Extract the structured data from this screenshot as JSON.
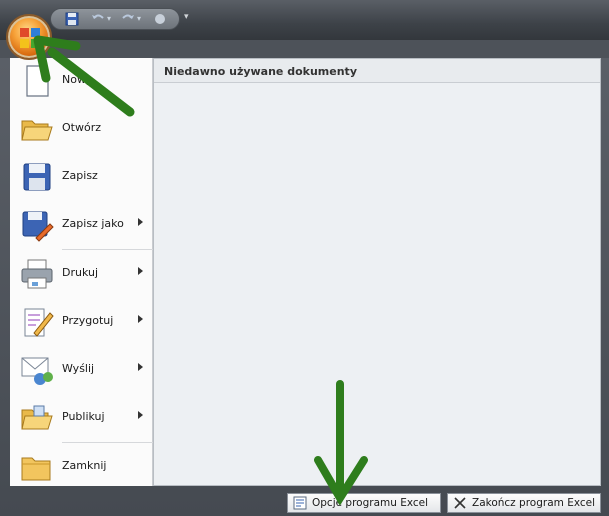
{
  "menu": {
    "commands": [
      {
        "label": "Nowy",
        "icon": "new-document-icon",
        "has_submenu": false
      },
      {
        "label": "Otwórz",
        "icon": "open-folder-icon",
        "has_submenu": false
      },
      {
        "label": "Zapisz",
        "icon": "save-disk-icon",
        "has_submenu": false
      },
      {
        "label": "Zapisz jako",
        "icon": "save-as-icon",
        "has_submenu": true
      },
      {
        "label": "Drukuj",
        "icon": "printer-icon",
        "has_submenu": true
      },
      {
        "label": "Przygotuj",
        "icon": "prepare-pen-icon",
        "has_submenu": true
      },
      {
        "label": "Wyślij",
        "icon": "send-icon",
        "has_submenu": true
      },
      {
        "label": "Publikuj",
        "icon": "publish-folder-icon",
        "has_submenu": true
      },
      {
        "label": "Zamknij",
        "icon": "close-folder-icon",
        "has_submenu": false
      }
    ]
  },
  "recent": {
    "title": "Niedawno używane dokumenty"
  },
  "footer": {
    "options_label": "Opcje programu Excel",
    "exit_label": "Zakończ program Excel"
  },
  "colors": {
    "annotation_arrow": "#2e7d1c",
    "frame_dark": "#454a51",
    "office_orange": "#f7a33a"
  }
}
